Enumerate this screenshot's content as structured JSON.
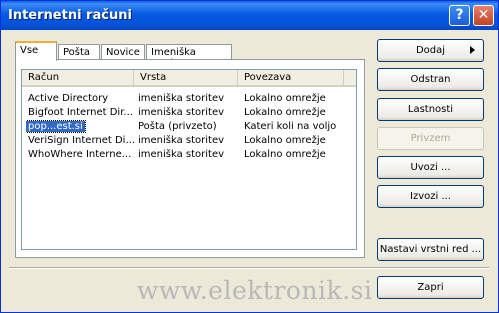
{
  "window": {
    "title": "Internetni računi",
    "help_glyph": "?",
    "close_glyph": "✕"
  },
  "tabs": [
    "Vse",
    "Pošta",
    "Novice",
    "Imeniška storitev"
  ],
  "table": {
    "columns": [
      "Račun",
      "Vrsta",
      "Povezava"
    ],
    "rows": [
      [
        "Active Directory",
        "imeniška storitev",
        "Lokalno omrežje"
      ],
      [
        "Bigfoot Internet Dir...",
        "imeniška storitev",
        "Lokalno omrežje"
      ],
      [
        "pop...est.si",
        "Pošta (privzeto)",
        "Kateri koli na voljo"
      ],
      [
        "VeriSign Internet Di...",
        "imeniška storitev",
        "Lokalno omrežje"
      ],
      [
        "WhoWhere Interne...",
        "imeniška storitev",
        "Lokalno omrežje"
      ]
    ],
    "selected_row": 2
  },
  "buttons": {
    "add": "Dodaj",
    "remove": "Odstran",
    "properties": "Lastnosti",
    "default": "Privzem",
    "import": "Uvozi ...",
    "export": "Izvozi ...",
    "set_order": "Nastavi vrstni red ...",
    "close": "Zapri"
  },
  "watermark": "www.elektronik.si"
}
